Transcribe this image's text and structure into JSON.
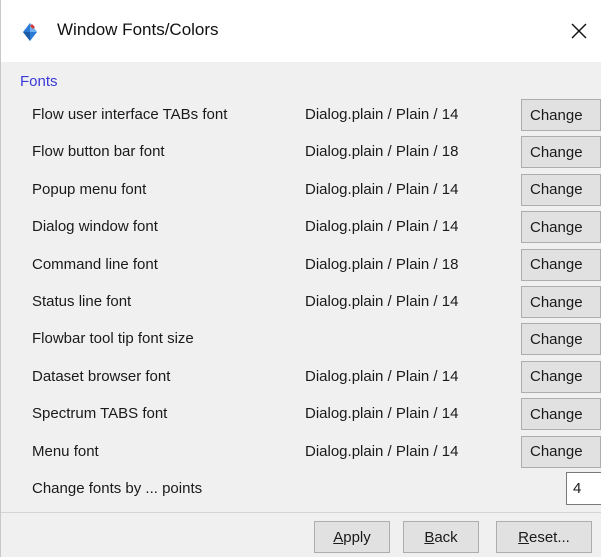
{
  "window": {
    "title": "Window Fonts/Colors",
    "app_icon": "diamond-app-icon",
    "close_icon": "close-icon",
    "close_glyph": "✕"
  },
  "fonts": {
    "section_label": "Fonts",
    "rows": [
      {
        "label": "Flow user interface TABs font",
        "value": "Dialog.plain / Plain / 14",
        "button": "Change"
      },
      {
        "label": "Flow button bar font",
        "value": "Dialog.plain / Plain / 18",
        "button": "Change"
      },
      {
        "label": "Popup menu font",
        "value": "Dialog.plain / Plain / 14",
        "button": "Change"
      },
      {
        "label": "Dialog window font",
        "value": "Dialog.plain / Plain / 14",
        "button": "Change"
      },
      {
        "label": "Command line font",
        "value": "Dialog.plain / Plain / 18",
        "button": "Change"
      },
      {
        "label": "Status line font",
        "value": "Dialog.plain / Plain / 14",
        "button": "Change"
      },
      {
        "label": "Flowbar tool tip font size",
        "value": "",
        "button": "Change"
      },
      {
        "label": "Dataset browser font",
        "value": "Dialog.plain / Plain / 14",
        "button": "Change"
      },
      {
        "label": "Spectrum TABS font",
        "value": "Dialog.plain / Plain / 14",
        "button": "Change"
      },
      {
        "label": "Menu font",
        "value": "Dialog.plain / Plain / 14",
        "button": "Change"
      }
    ],
    "change_by": {
      "label": "Change fonts by ... points",
      "value": "4"
    }
  },
  "footer": {
    "apply": {
      "mnemonic": "A",
      "rest": "pply"
    },
    "back": {
      "mnemonic": "B",
      "rest": "ack"
    },
    "reset": {
      "mnemonic": "R",
      "rest": "eset..."
    }
  },
  "colors": {
    "section_label": "#3a3ad8",
    "panel_bg": "#f0f0f0",
    "button_bg": "#e1e1e1",
    "app_icon_blue": "#2c7bd6"
  }
}
